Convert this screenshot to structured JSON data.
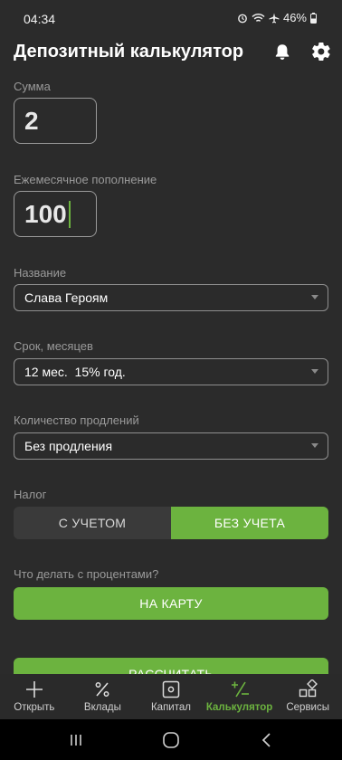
{
  "status": {
    "time": "04:34",
    "battery": "46%"
  },
  "app_bar": {
    "title": "Депозитный калькулятор",
    "icons": [
      "bell-icon",
      "gear-icon"
    ]
  },
  "form": {
    "sum": {
      "label": "Сумма",
      "value": "2"
    },
    "monthly": {
      "label": "Ежемесячное пополнение",
      "value": "100"
    },
    "name": {
      "label": "Название",
      "value": "Слава Героям"
    },
    "term": {
      "label": "Срок, месяцев",
      "value": "12 мес.  15% год."
    },
    "renewals": {
      "label": "Количество продлений",
      "value": "Без продления"
    },
    "tax": {
      "label": "Налог",
      "options": [
        "С УЧЕТОМ",
        "БЕЗ УЧЕТА"
      ],
      "selected": "БЕЗ УЧЕТА"
    },
    "interest": {
      "label": "Что делать с процентами?",
      "button": "НА КАРТУ"
    },
    "calculate": "РАССЧИТАТЬ"
  },
  "bottom_nav": [
    {
      "label": "Открыть",
      "icon": "plus-icon"
    },
    {
      "label": "Вклады",
      "icon": "percent-icon"
    },
    {
      "label": "Капитал",
      "icon": "capital-icon"
    },
    {
      "label": "Калькулятор",
      "icon": "calculator-icon",
      "active": true
    },
    {
      "label": "Сервисы",
      "icon": "services-icon"
    }
  ],
  "colors": {
    "accent": "#6cb33f",
    "background": "#2b2b2b"
  }
}
